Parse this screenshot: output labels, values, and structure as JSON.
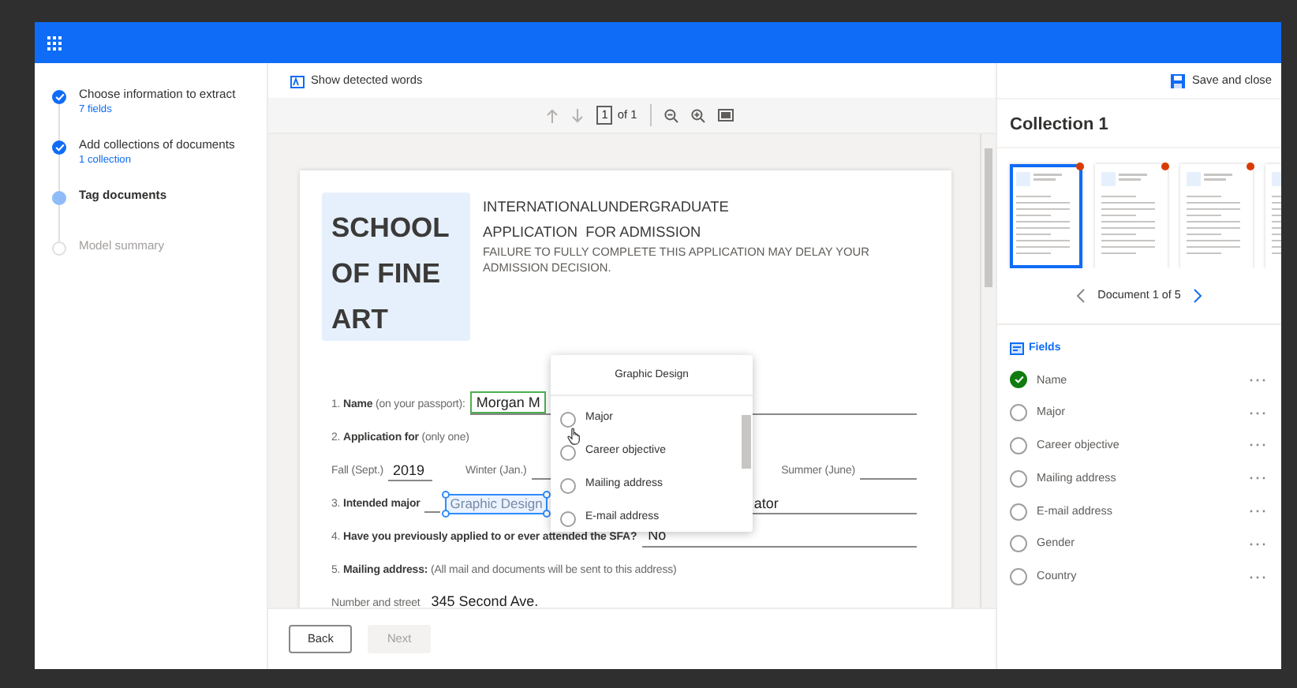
{
  "steps": [
    {
      "label": "Choose information to extract",
      "sublabel": "7 fields",
      "completed": true,
      "current": false
    },
    {
      "label": "Add collections of documents",
      "sublabel": "1 collection",
      "completed": true,
      "current": false
    },
    {
      "label": "Tag documents",
      "completed": false,
      "current": true
    },
    {
      "label": "Model summary",
      "completed": false,
      "current": false
    }
  ],
  "toolbar": {
    "show_words": "Show detected words",
    "save": "Save and close"
  },
  "pager": {
    "page": "1",
    "total": "of 1"
  },
  "document": {
    "school": [
      "SCHOOL",
      "OF FINE",
      "ART"
    ],
    "heading": [
      "INTERNATIONALUNDERGRADUATE",
      "APPLICATION  FOR ADMISSION"
    ],
    "notice": "FAILURE TO FULLY COMPLETE THIS APPLICATION MAY DELAY YOUR ADMISSION DECISION.",
    "form": [
      {
        "kind": "field",
        "label": "1. **Name** (on your passport):",
        "value": "Morgan M",
        "tagged": true
      },
      {
        "kind": "heading",
        "label": "2. **Application for** (only one)"
      },
      {
        "kind": "terms",
        "terms": [
          {
            "label": "Fall (Sept.)",
            "value": "2019"
          },
          {
            "label": "Winter (Jan.)"
          },
          {
            "label": "Summer (June)"
          }
        ]
      },
      {
        "kind": "major",
        "label": "3. **Intended major**",
        "value": "Graphic Design",
        "selected": true,
        "tail": "ator"
      },
      {
        "kind": "field",
        "label": "4. **Have you previously applied to or ever attended the SFA?**",
        "value": "No",
        "tagged": false
      },
      {
        "kind": "heading",
        "label": "5. **Mailing address:** (All mail and documents will be sent to this address)"
      },
      {
        "kind": "field",
        "label": "Number and street",
        "value": "345 Second Ave.",
        "tagged": false
      }
    ]
  },
  "popup": {
    "title": "Graphic Design",
    "options": [
      {
        "label": "Major",
        "selected": false
      },
      {
        "label": "Career objective",
        "selected": false
      },
      {
        "label": "Mailing address",
        "selected": false
      },
      {
        "label": "E-mail address",
        "selected": false
      }
    ]
  },
  "footer": {
    "back": "Back",
    "next": {
      "label": "Next",
      "disabled": true
    }
  },
  "collection": {
    "title": "Collection 1",
    "thumbnails": [
      {
        "selected": true,
        "flagged": true
      },
      {
        "selected": false,
        "flagged": true
      },
      {
        "selected": false,
        "flagged": true
      },
      {
        "selected": false
      }
    ],
    "nav": "Document 1 of 5",
    "fields_title": "Fields",
    "fields": [
      {
        "label": "Name",
        "tagged": true
      },
      {
        "label": "Major",
        "tagged": false
      },
      {
        "label": "Career objective",
        "tagged": false
      },
      {
        "label": "Mailing address",
        "tagged": false
      },
      {
        "label": "E-mail address",
        "tagged": false
      },
      {
        "label": "Gender",
        "tagged": false
      },
      {
        "label": "Country",
        "tagged": false
      }
    ]
  }
}
